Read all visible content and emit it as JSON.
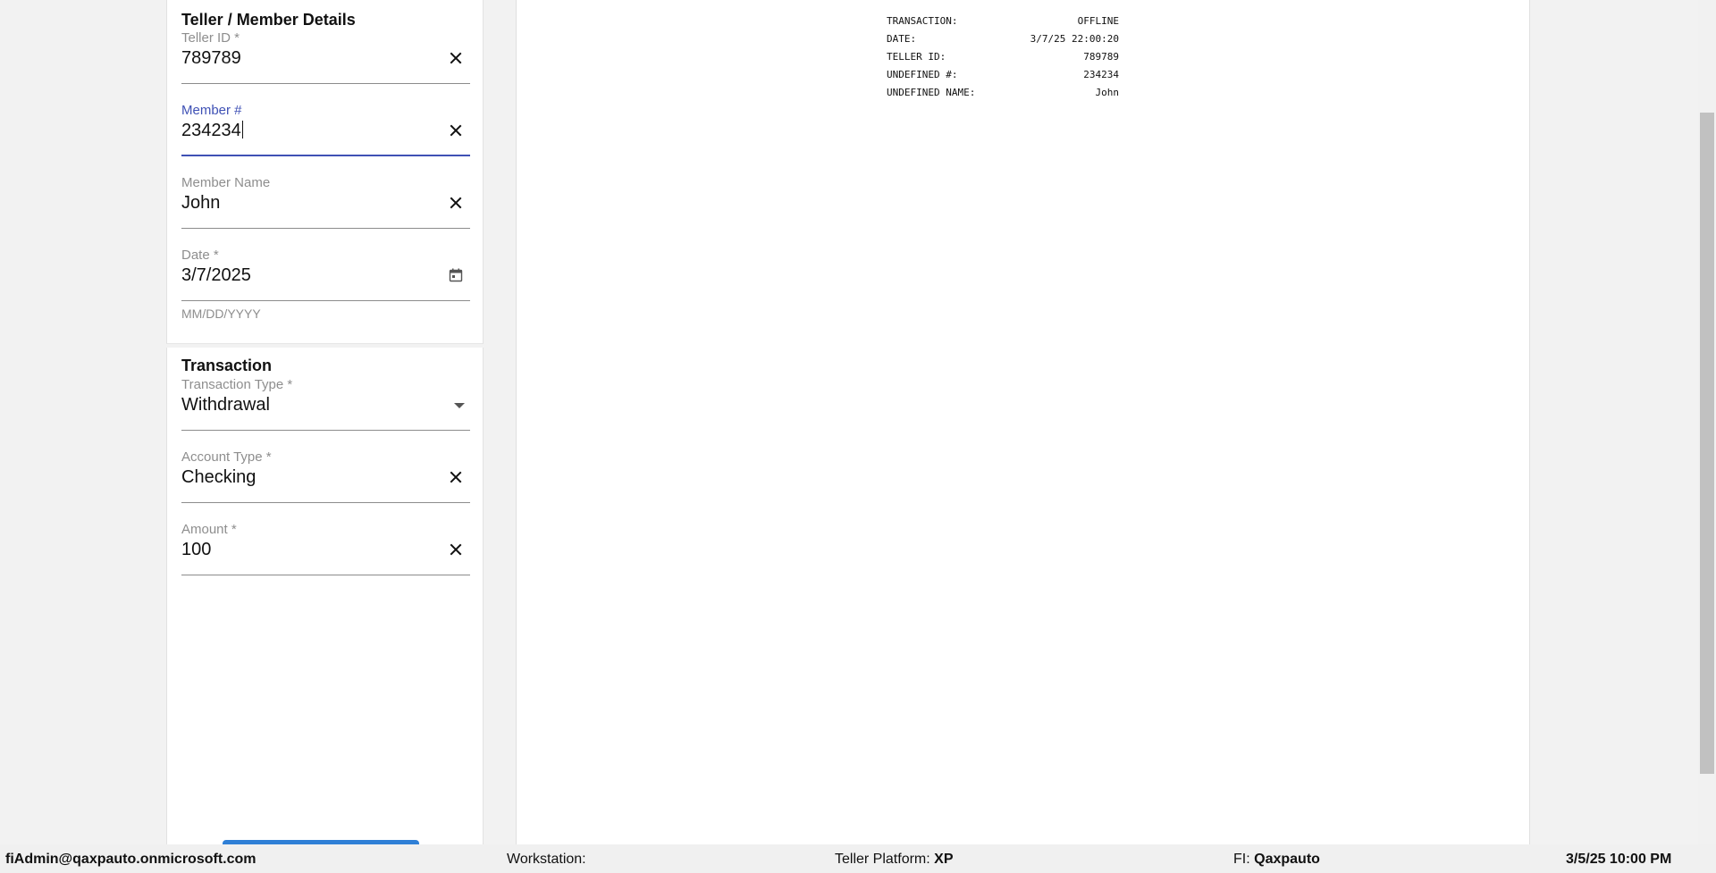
{
  "teller_member_details": {
    "title": "Teller / Member Details",
    "teller_id": {
      "label": "Teller ID *",
      "value": "789789"
    },
    "member_number": {
      "label": "Member #",
      "value": "234234"
    },
    "member_name": {
      "label": "Member Name",
      "value": "John"
    },
    "date": {
      "label": "Date *",
      "value": "3/7/2025",
      "helper": "MM/DD/YYYY"
    }
  },
  "transaction": {
    "title": "Transaction",
    "transaction_type": {
      "label": "Transaction Type *",
      "value": "Withdrawal"
    },
    "account_type": {
      "label": "Account Type *",
      "value": "Checking"
    },
    "amount": {
      "label": "Amount *",
      "value": "100"
    }
  },
  "receipt": {
    "rows": [
      {
        "label": "TRANSACTION:",
        "value": "OFFLINE"
      },
      {
        "label": "DATE:",
        "value": "3/7/25 22:00:20"
      },
      {
        "label": "TELLER ID:",
        "value": "789789"
      },
      {
        "label": "UNDEFINED #:",
        "value": "234234"
      },
      {
        "label": "UNDEFINED NAME:",
        "value": "John"
      }
    ]
  },
  "status_bar": {
    "user": "fiAdmin@qaxpauto.onmicrosoft.com",
    "workstation_label": "Workstation:",
    "workstation_value": "",
    "platform_label": "Teller Platform:",
    "platform_value": "XP",
    "fi_label": "FI:",
    "fi_value": "Qaxpauto",
    "datetime": "3/5/25 10:00 PM"
  },
  "icons": {
    "clear": "close-icon",
    "calendar": "calendar-icon",
    "dropdown": "arrow-drop-down-icon"
  },
  "colors": {
    "focus": "#3f51b5",
    "primary_button": "#2f7fd6"
  }
}
